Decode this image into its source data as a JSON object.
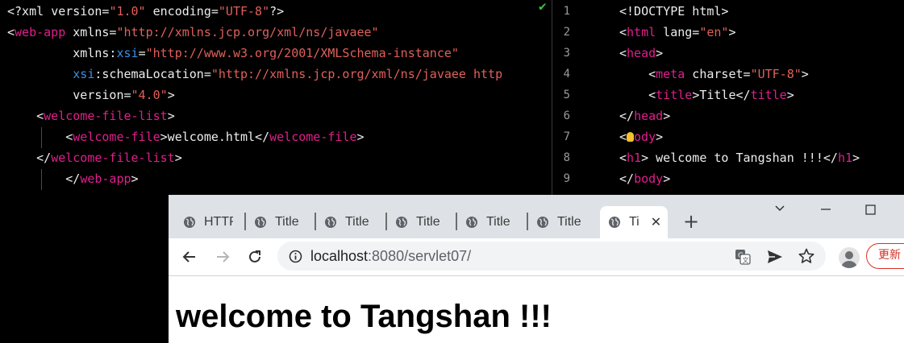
{
  "left_editor": {
    "lines": [
      [
        {
          "t": "<?xml ",
          "c": "attr"
        },
        {
          "t": "version=",
          "c": "attr"
        },
        {
          "t": "\"1.0\"",
          "c": "str"
        },
        {
          "t": " encoding=",
          "c": "attr"
        },
        {
          "t": "\"UTF-8\"",
          "c": "str"
        },
        {
          "t": "?>",
          "c": "attr"
        }
      ],
      [
        {
          "t": "<",
          "c": "attr"
        },
        {
          "t": "web-app",
          "c": "tag"
        },
        {
          "t": " xmlns=",
          "c": "attr"
        },
        {
          "t": "\"http://xmlns.jcp.org/xml/ns/javaee\"",
          "c": "str"
        }
      ],
      [
        {
          "t": "         xmlns:",
          "c": "attr"
        },
        {
          "t": "xsi",
          "c": "ns"
        },
        {
          "t": "=",
          "c": "attr"
        },
        {
          "t": "\"http://www.w3.org/2001/XMLSchema-instance\"",
          "c": "str"
        }
      ],
      [
        {
          "t": "         ",
          "c": "attr"
        },
        {
          "t": "xsi",
          "c": "ns"
        },
        {
          "t": ":schemaLocation=",
          "c": "attr"
        },
        {
          "t": "\"http://xmlns.jcp.org/xml/ns/javaee http",
          "c": "str"
        }
      ],
      [
        {
          "t": "         version=",
          "c": "attr"
        },
        {
          "t": "\"4.0\"",
          "c": "str"
        },
        {
          "t": ">",
          "c": "attr"
        }
      ],
      [
        {
          "t": "    <",
          "c": "attr"
        },
        {
          "t": "welcome-file-list",
          "c": "tag"
        },
        {
          "t": ">",
          "c": "attr"
        }
      ],
      [
        {
          "t": "        <",
          "c": "attr"
        },
        {
          "t": "welcome-file",
          "c": "tag"
        },
        {
          "t": ">welcome.html</",
          "c": "attr"
        },
        {
          "t": "welcome-file",
          "c": "tag"
        },
        {
          "t": ">",
          "c": "attr"
        }
      ],
      [
        {
          "t": "    </",
          "c": "attr"
        },
        {
          "t": "welcome-file-list",
          "c": "tag"
        },
        {
          "t": ">",
          "c": "attr"
        }
      ],
      [
        {
          "t": "        </",
          "c": "attr"
        },
        {
          "t": "web-app",
          "c": "tag"
        },
        {
          "t": ">",
          "c": "attr"
        }
      ]
    ]
  },
  "right_editor": {
    "line_numbers": [
      "1",
      "2",
      "3",
      "4",
      "5",
      "6",
      "7",
      "8",
      "9"
    ],
    "lines": [
      [
        {
          "t": "<!DOCTYPE html>",
          "c": "attr"
        }
      ],
      [
        {
          "t": "<",
          "c": "attr"
        },
        {
          "t": "html",
          "c": "tag"
        },
        {
          "t": " lang=",
          "c": "attr"
        },
        {
          "t": "\"en\"",
          "c": "str"
        },
        {
          "t": ">",
          "c": "attr"
        }
      ],
      [
        {
          "t": "<",
          "c": "attr"
        },
        {
          "t": "head",
          "c": "tag"
        },
        {
          "t": ">",
          "c": "attr"
        }
      ],
      [
        {
          "t": "    <",
          "c": "attr"
        },
        {
          "t": "meta",
          "c": "tag"
        },
        {
          "t": " charset=",
          "c": "attr"
        },
        {
          "t": "\"UTF-8\"",
          "c": "str"
        },
        {
          "t": ">",
          "c": "attr"
        }
      ],
      [
        {
          "t": "    <",
          "c": "attr"
        },
        {
          "t": "title",
          "c": "tag"
        },
        {
          "t": ">Title</",
          "c": "attr"
        },
        {
          "t": "title",
          "c": "tag"
        },
        {
          "t": ">",
          "c": "attr"
        }
      ],
      [
        {
          "t": "</",
          "c": "attr"
        },
        {
          "t": "head",
          "c": "tag"
        },
        {
          "t": ">",
          "c": "attr"
        }
      ],
      [
        {
          "t": "<",
          "c": "attr"
        },
        {
          "t": "BULB",
          "c": "bulb"
        },
        {
          "t": "ody",
          "c": "tag"
        },
        {
          "t": ">",
          "c": "attr"
        }
      ],
      [
        {
          "t": "<",
          "c": "attr"
        },
        {
          "t": "h1",
          "c": "tag"
        },
        {
          "t": "> welcome to Tangshan !!!</",
          "c": "attr"
        },
        {
          "t": "h1",
          "c": "tag"
        },
        {
          "t": ">",
          "c": "attr"
        }
      ],
      [
        {
          "t": "</",
          "c": "attr"
        },
        {
          "t": "body",
          "c": "tag"
        },
        {
          "t": ">",
          "c": "attr"
        }
      ]
    ]
  },
  "browser": {
    "tabs": [
      {
        "label": "HTTP",
        "active": false
      },
      {
        "label": "Title",
        "active": false
      },
      {
        "label": "Title",
        "active": false
      },
      {
        "label": "Title",
        "active": false
      },
      {
        "label": "Title",
        "active": false
      },
      {
        "label": "Title",
        "active": false
      },
      {
        "label": "Ti",
        "active": true
      }
    ],
    "url_host": "localhost",
    "url_rest": ":8080/servlet07/",
    "update_label": "更新",
    "page_heading": "welcome to Tangshan !!!"
  }
}
